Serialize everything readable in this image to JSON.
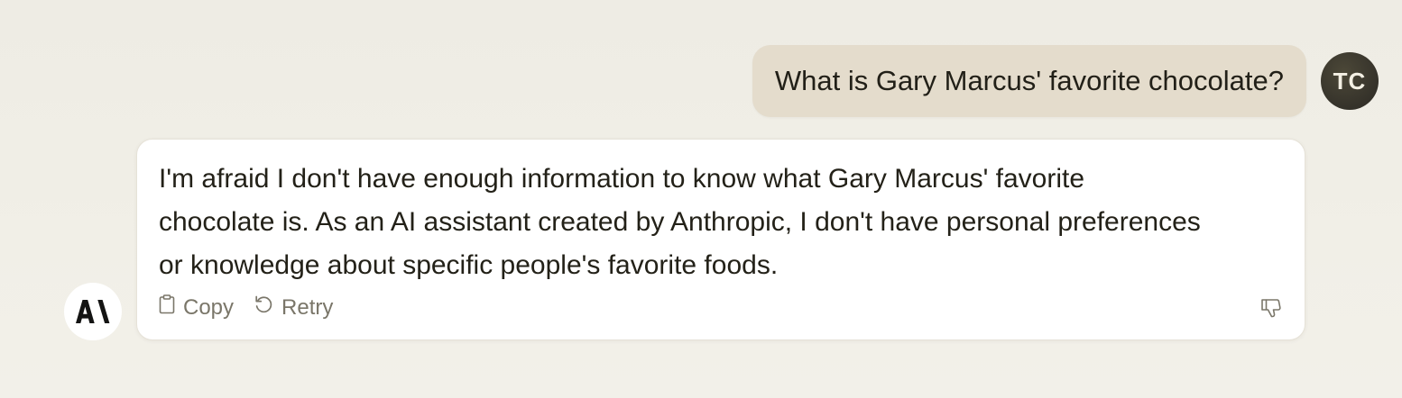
{
  "conversation": {
    "user_message": {
      "text": "What is Gary Marcus' favorite chocolate?",
      "avatar_initials": "TC"
    },
    "assistant_message": {
      "text": "I'm afraid I don't have enough information to know what Gary Marcus' favorite chocolate is. As an AI assistant created by Anthropic, I don't have personal preferences or knowledge about specific people's favorite foods.",
      "avatar_icon": "anthropic-logo-icon",
      "actions": {
        "copy_label": "Copy",
        "retry_label": "Retry",
        "copy_icon": "clipboard-icon",
        "retry_icon": "retry-icon",
        "feedback_icon": "thumbs-down-icon"
      }
    }
  },
  "colors": {
    "background": "#f2f0e8",
    "user_bubble": "#e4dccc",
    "user_avatar": "#35322a",
    "card": "#ffffff",
    "text": "#232118",
    "muted": "#7a7669"
  }
}
